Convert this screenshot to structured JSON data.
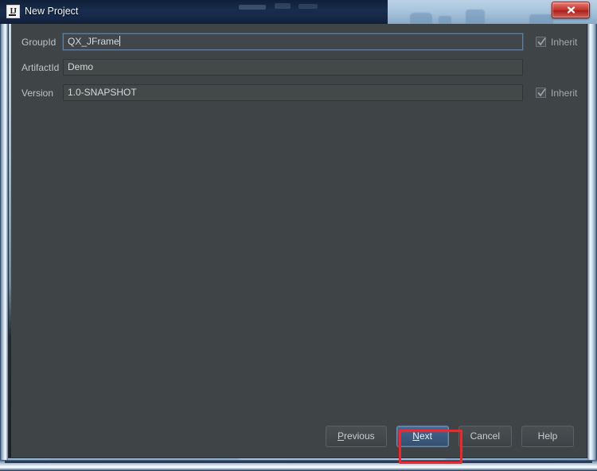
{
  "window": {
    "title": "New Project",
    "app_icon": "intellij-idea-icon",
    "close_icon": "close-icon",
    "close_label": "x"
  },
  "form": {
    "rows": [
      {
        "label": "GroupId",
        "value": "QX_JFrame",
        "focused": true,
        "has_inherit": true,
        "inherit_label": "Inherit",
        "inherit_checked": true
      },
      {
        "label": "ArtifactId",
        "value": "Demo",
        "focused": false,
        "has_inherit": false,
        "inherit_label": "",
        "inherit_checked": false
      },
      {
        "label": "Version",
        "value": "1.0-SNAPSHOT",
        "focused": false,
        "has_inherit": true,
        "inherit_label": "Inherit",
        "inherit_checked": true
      }
    ]
  },
  "buttons": {
    "previous": {
      "mnemonic": "P",
      "rest": "revious"
    },
    "next": {
      "mnemonic": "N",
      "rest": "ext"
    },
    "cancel": {
      "label": "Cancel"
    },
    "help": {
      "label": "Help"
    }
  },
  "annotation": {
    "target": "next-button",
    "color": "#f4262a"
  },
  "colors": {
    "dialog_background": "#3f4447",
    "titlebar": "#16294a",
    "primary_button": "#3d5a80",
    "close_button": "#c0302a",
    "accent_highlight": "#f4262a"
  }
}
